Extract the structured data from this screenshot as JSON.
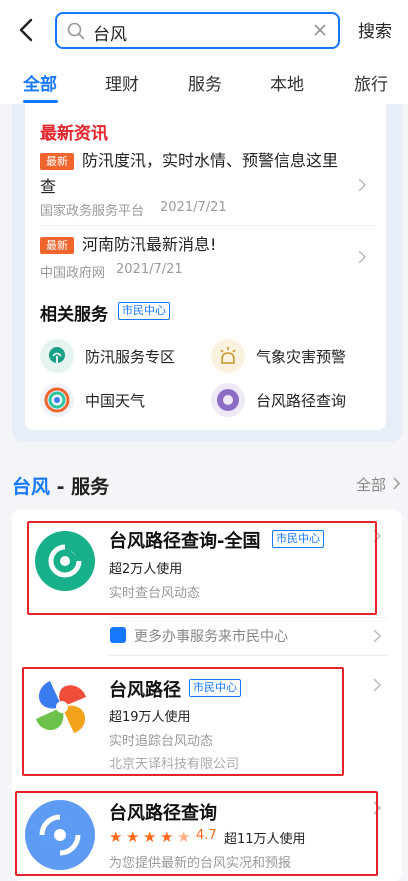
{
  "search": {
    "query": "台风",
    "button": "搜索"
  },
  "tabs": [
    "全部",
    "理财",
    "服务",
    "本地",
    "旅行"
  ],
  "news": {
    "title": "最新资讯",
    "badge": "最新",
    "items": [
      {
        "title_line1": "防汛度汛，实时水情、预警信息这里",
        "title_line2": "查",
        "source": "国家政务服务平台",
        "date": "2021/7/21"
      },
      {
        "title_line1": "河南防汛最新消息!",
        "source": "中国政府网",
        "date": "2021/7/21"
      }
    ]
  },
  "related": {
    "title": "相关服务",
    "tag": "市民中心",
    "items": [
      "防汛服务专区",
      "气象灾害预警",
      "中国天气",
      "台风路径查询"
    ]
  },
  "services": {
    "title_keyword": "台风",
    "title_suffix": " - 服务",
    "all_label": "全部",
    "tag": "市民中心",
    "more": "更多办事服务来市民中心",
    "apps": [
      {
        "name": "台风路径查询-全国",
        "users": "超2万人使用",
        "desc": "实时查台风动态"
      },
      {
        "name": "台风路径",
        "users": "超19万人使用",
        "desc": "实时追踪台风动态",
        "developer": "北京天译科技有限公司"
      },
      {
        "name": "台风路径查询",
        "rating": "4.7",
        "rating_value": 4.7,
        "users": "超11万人使用",
        "desc": "为您提供最新的台风实况和预报"
      }
    ]
  },
  "colors": {
    "accent": "#1677ff",
    "badge": "#f0642d",
    "highlight": "#e5242b",
    "star": "#ff6a1a"
  }
}
